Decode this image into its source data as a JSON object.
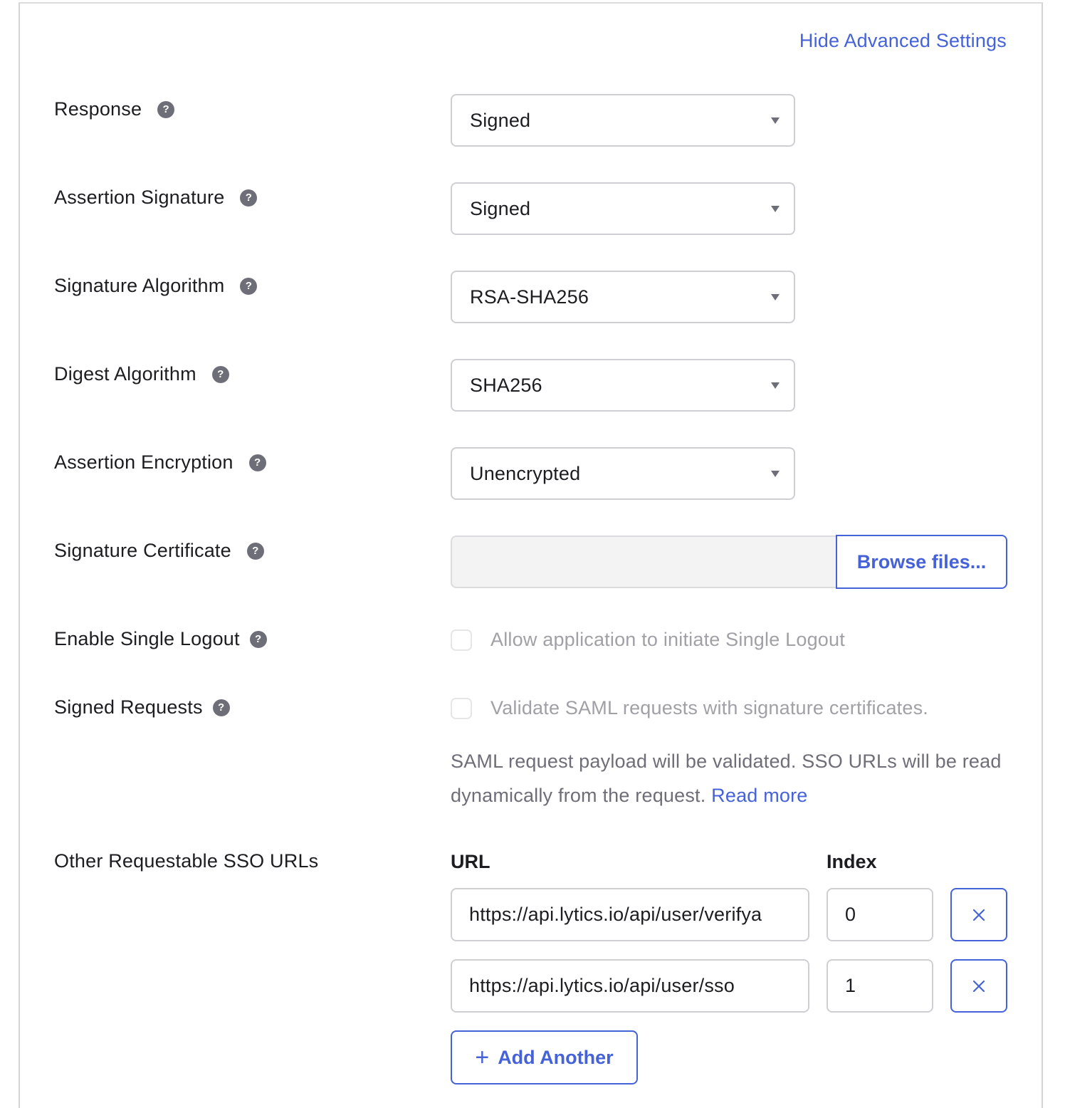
{
  "header": {
    "toggle_advanced_label": "Hide Advanced Settings"
  },
  "fields": {
    "response": {
      "label": "Response",
      "value": "Signed"
    },
    "assertion_signature": {
      "label": "Assertion Signature",
      "value": "Signed"
    },
    "signature_algorithm": {
      "label": "Signature Algorithm",
      "value": "RSA-SHA256"
    },
    "digest_algorithm": {
      "label": "Digest Algorithm",
      "value": "SHA256"
    },
    "assertion_encryption": {
      "label": "Assertion Encryption",
      "value": "Unencrypted"
    },
    "signature_certificate": {
      "label": "Signature Certificate",
      "value": "",
      "browse_label": "Browse files..."
    },
    "enable_single_logout": {
      "label": "Enable Single Logout",
      "checkbox_label": "Allow application to initiate Single Logout",
      "checked": false
    },
    "signed_requests": {
      "label": "Signed Requests",
      "checkbox_label": "Validate SAML requests with signature certificates.",
      "checked": false,
      "description": "SAML request payload will be validated. SSO URLs will be read dynamically from the request.",
      "read_more_label": "Read more"
    }
  },
  "sso_urls": {
    "label": "Other Requestable SSO URLs",
    "url_header": "URL",
    "index_header": "Index",
    "rows": [
      {
        "url": "https://api.lytics.io/api/user/verifya",
        "index": "0"
      },
      {
        "url": "https://api.lytics.io/api/user/sso",
        "index": "1"
      }
    ],
    "add_label": "Add Another"
  },
  "icons": {
    "help": "?",
    "remove": "close-icon",
    "add": "+"
  },
  "colors": {
    "accent": "#4662d9",
    "help_icon": "#6e6e78",
    "border": "#cfcfd3"
  }
}
